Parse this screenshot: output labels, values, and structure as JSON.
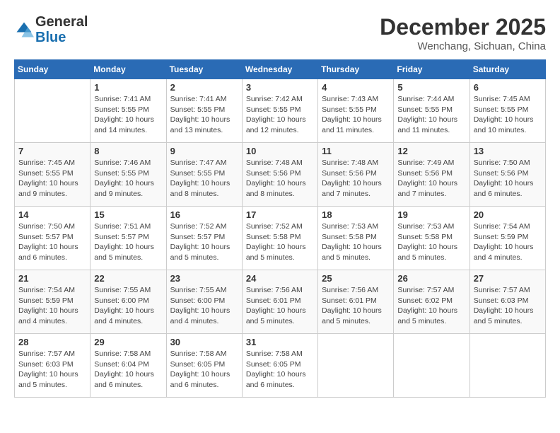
{
  "header": {
    "logo_line1": "General",
    "logo_line2": "Blue",
    "month": "December 2025",
    "location": "Wenchang, Sichuan, China"
  },
  "days_of_week": [
    "Sunday",
    "Monday",
    "Tuesday",
    "Wednesday",
    "Thursday",
    "Friday",
    "Saturday"
  ],
  "weeks": [
    [
      {
        "num": "",
        "detail": ""
      },
      {
        "num": "1",
        "detail": "Sunrise: 7:41 AM\nSunset: 5:55 PM\nDaylight: 10 hours\nand 14 minutes."
      },
      {
        "num": "2",
        "detail": "Sunrise: 7:41 AM\nSunset: 5:55 PM\nDaylight: 10 hours\nand 13 minutes."
      },
      {
        "num": "3",
        "detail": "Sunrise: 7:42 AM\nSunset: 5:55 PM\nDaylight: 10 hours\nand 12 minutes."
      },
      {
        "num": "4",
        "detail": "Sunrise: 7:43 AM\nSunset: 5:55 PM\nDaylight: 10 hours\nand 11 minutes."
      },
      {
        "num": "5",
        "detail": "Sunrise: 7:44 AM\nSunset: 5:55 PM\nDaylight: 10 hours\nand 11 minutes."
      },
      {
        "num": "6",
        "detail": "Sunrise: 7:45 AM\nSunset: 5:55 PM\nDaylight: 10 hours\nand 10 minutes."
      }
    ],
    [
      {
        "num": "7",
        "detail": "Sunrise: 7:45 AM\nSunset: 5:55 PM\nDaylight: 10 hours\nand 9 minutes."
      },
      {
        "num": "8",
        "detail": "Sunrise: 7:46 AM\nSunset: 5:55 PM\nDaylight: 10 hours\nand 9 minutes."
      },
      {
        "num": "9",
        "detail": "Sunrise: 7:47 AM\nSunset: 5:55 PM\nDaylight: 10 hours\nand 8 minutes."
      },
      {
        "num": "10",
        "detail": "Sunrise: 7:48 AM\nSunset: 5:56 PM\nDaylight: 10 hours\nand 8 minutes."
      },
      {
        "num": "11",
        "detail": "Sunrise: 7:48 AM\nSunset: 5:56 PM\nDaylight: 10 hours\nand 7 minutes."
      },
      {
        "num": "12",
        "detail": "Sunrise: 7:49 AM\nSunset: 5:56 PM\nDaylight: 10 hours\nand 7 minutes."
      },
      {
        "num": "13",
        "detail": "Sunrise: 7:50 AM\nSunset: 5:56 PM\nDaylight: 10 hours\nand 6 minutes."
      }
    ],
    [
      {
        "num": "14",
        "detail": "Sunrise: 7:50 AM\nSunset: 5:57 PM\nDaylight: 10 hours\nand 6 minutes."
      },
      {
        "num": "15",
        "detail": "Sunrise: 7:51 AM\nSunset: 5:57 PM\nDaylight: 10 hours\nand 5 minutes."
      },
      {
        "num": "16",
        "detail": "Sunrise: 7:52 AM\nSunset: 5:57 PM\nDaylight: 10 hours\nand 5 minutes."
      },
      {
        "num": "17",
        "detail": "Sunrise: 7:52 AM\nSunset: 5:58 PM\nDaylight: 10 hours\nand 5 minutes."
      },
      {
        "num": "18",
        "detail": "Sunrise: 7:53 AM\nSunset: 5:58 PM\nDaylight: 10 hours\nand 5 minutes."
      },
      {
        "num": "19",
        "detail": "Sunrise: 7:53 AM\nSunset: 5:58 PM\nDaylight: 10 hours\nand 5 minutes."
      },
      {
        "num": "20",
        "detail": "Sunrise: 7:54 AM\nSunset: 5:59 PM\nDaylight: 10 hours\nand 4 minutes."
      }
    ],
    [
      {
        "num": "21",
        "detail": "Sunrise: 7:54 AM\nSunset: 5:59 PM\nDaylight: 10 hours\nand 4 minutes."
      },
      {
        "num": "22",
        "detail": "Sunrise: 7:55 AM\nSunset: 6:00 PM\nDaylight: 10 hours\nand 4 minutes."
      },
      {
        "num": "23",
        "detail": "Sunrise: 7:55 AM\nSunset: 6:00 PM\nDaylight: 10 hours\nand 4 minutes."
      },
      {
        "num": "24",
        "detail": "Sunrise: 7:56 AM\nSunset: 6:01 PM\nDaylight: 10 hours\nand 5 minutes."
      },
      {
        "num": "25",
        "detail": "Sunrise: 7:56 AM\nSunset: 6:01 PM\nDaylight: 10 hours\nand 5 minutes."
      },
      {
        "num": "26",
        "detail": "Sunrise: 7:57 AM\nSunset: 6:02 PM\nDaylight: 10 hours\nand 5 minutes."
      },
      {
        "num": "27",
        "detail": "Sunrise: 7:57 AM\nSunset: 6:03 PM\nDaylight: 10 hours\nand 5 minutes."
      }
    ],
    [
      {
        "num": "28",
        "detail": "Sunrise: 7:57 AM\nSunset: 6:03 PM\nDaylight: 10 hours\nand 5 minutes."
      },
      {
        "num": "29",
        "detail": "Sunrise: 7:58 AM\nSunset: 6:04 PM\nDaylight: 10 hours\nand 6 minutes."
      },
      {
        "num": "30",
        "detail": "Sunrise: 7:58 AM\nSunset: 6:05 PM\nDaylight: 10 hours\nand 6 minutes."
      },
      {
        "num": "31",
        "detail": "Sunrise: 7:58 AM\nSunset: 6:05 PM\nDaylight: 10 hours\nand 6 minutes."
      },
      {
        "num": "",
        "detail": ""
      },
      {
        "num": "",
        "detail": ""
      },
      {
        "num": "",
        "detail": ""
      }
    ]
  ]
}
